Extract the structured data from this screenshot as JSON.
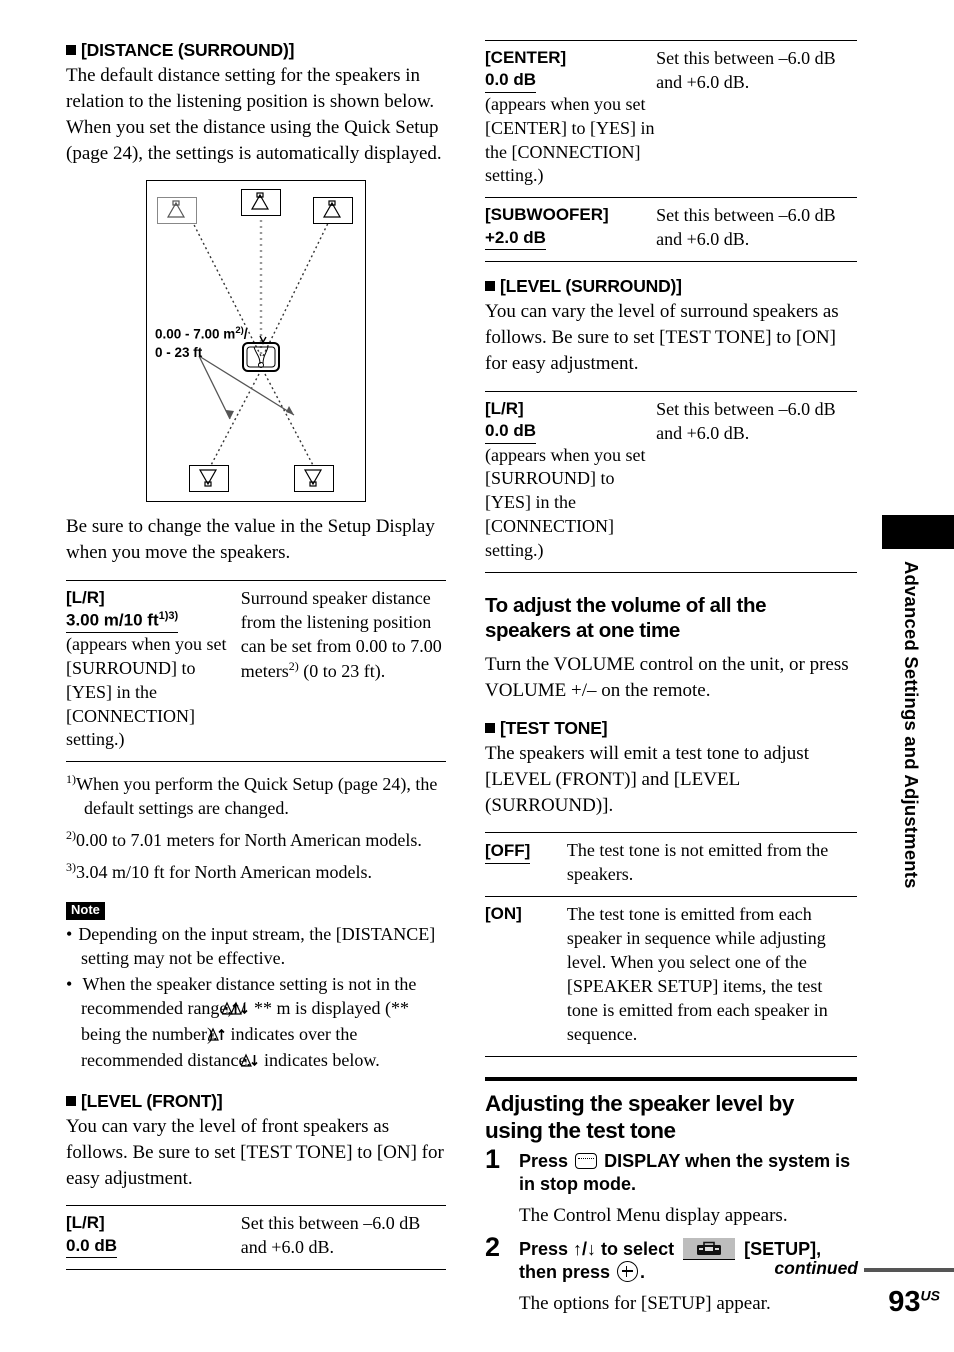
{
  "left": {
    "distance_heading": "[DISTANCE (SURROUND)]",
    "distance_intro": "The default distance setting for the speakers in relation to the listening position is shown below. When you set the distance using the Quick Setup (page 24), the settings is automatically displayed.",
    "diagram": {
      "name": "speaker-placement-diagram",
      "distance_label_line1_pre": "0.00 - 7.00 m",
      "distance_label_line1_sup": "2)",
      "distance_label_line1_post": "/",
      "distance_label_line2": "0 - 23 ft",
      "speakers": [
        "front-left-speaker",
        "center-speaker",
        "front-right-speaker",
        "surround-left-speaker",
        "surround-right-speaker"
      ],
      "listener": "listening-position-tv"
    },
    "after_diagram": "Be sure to change the value in the Setup Display when you move the speakers.",
    "distance_table": [
      {
        "key_name": "[L/R]",
        "key_default": "3.00 m/10 ft",
        "key_default_sup": "1)3)",
        "key_note": "(appears when you set [SURROUND] to [YES] in the [CONNECTION] setting.)",
        "value": "Surround speaker distance from the listening position can be set from 0.00 to 7.00 meters2) (0 to 23 ft)."
      }
    ],
    "footnotes": [
      {
        "mark": "1)",
        "text": "When you perform the Quick Setup (page 24), the default settings are changed."
      },
      {
        "mark": "2)",
        "text": "0.00 to 7.01 meters for North American models."
      },
      {
        "mark": "3)",
        "text": "3.04 m/10 ft for North American models."
      }
    ],
    "note_badge": "Note",
    "notes": [
      "Depending on the input stream, the [DISTANCE] setting may not be effective.",
      "When the speaker distance setting is not in the recommended range,  / ** m is displayed (** being the number).  indicates over the recommended distance.  indicates below."
    ],
    "note2_parts": {
      "a": "When the speaker distance setting is not in the recommended range,",
      "b": "/",
      "c": "** m is displayed (** being the number).",
      "d": "indicates over the recommended distance.",
      "e": "indicates below."
    },
    "level_front_heading": "[LEVEL (FRONT)]",
    "level_front_intro": "You can vary the level of front speakers as follows. Be sure to set [TEST TONE] to [ON] for easy adjustment.",
    "level_front_table": [
      {
        "key_name": "[L/R]",
        "key_default": "0.0 dB",
        "value": "Set this between –6.0 dB and +6.0 dB."
      }
    ]
  },
  "right": {
    "level_front_table_cont": [
      {
        "key_name": "[CENTER]",
        "key_default": "0.0 dB",
        "key_note": "(appears when you set [CENTER] to [YES] in the [CONNECTION] setting.)",
        "value": "Set this between –6.0 dB and +6.0 dB."
      },
      {
        "key_name": "[SUBWOOFER]",
        "key_default": "+2.0 dB",
        "value": "Set this between –6.0 dB and +6.0 dB."
      }
    ],
    "level_surround_heading": "[LEVEL (SURROUND)]",
    "level_surround_intro": "You can vary the level of surround speakers as follows. Be sure to set [TEST TONE] to [ON] for easy adjustment.",
    "level_surround_table": [
      {
        "key_name": "[L/R]",
        "key_default": "0.0 dB",
        "key_note": "(appears when you set [SURROUND] to [YES] in the [CONNECTION] setting.)",
        "value": "Set this between –6.0 dB and +6.0 dB."
      }
    ],
    "volume_heading": "To adjust the volume of all the speakers at one time",
    "volume_text": "Turn the VOLUME control on the unit, or press VOLUME +/– on the remote.",
    "test_tone_heading": "[TEST TONE]",
    "test_tone_intro": "The speakers will emit a test tone to adjust [LEVEL (FRONT)] and [LEVEL (SURROUND)].",
    "test_tone_table": [
      {
        "key_name": "[OFF]",
        "value": "The test tone is not emitted from the speakers."
      },
      {
        "key_name": "[ON]",
        "value": "The test tone is emitted from each speaker in sequence while adjusting level. When you select one of the [SPEAKER SETUP] items, the test tone is emitted from each speaker in sequence."
      }
    ],
    "adjust_heading": "Adjusting the speaker level by using the test tone",
    "steps": [
      {
        "num": "1",
        "title_a": "Press",
        "title_b": "DISPLAY when the system is in stop mode.",
        "desc": "The Control Menu display appears."
      },
      {
        "num": "2",
        "title_a": "Press ↑/↓ to select",
        "title_b": "[SETUP], then press",
        "title_c": ".",
        "desc": "The options for [SETUP] appear."
      }
    ]
  },
  "side_tab": {
    "label": "Advanced Settings and Adjustments"
  },
  "footer": {
    "continued": "continued",
    "page_number": "93",
    "page_suffix": "US"
  }
}
